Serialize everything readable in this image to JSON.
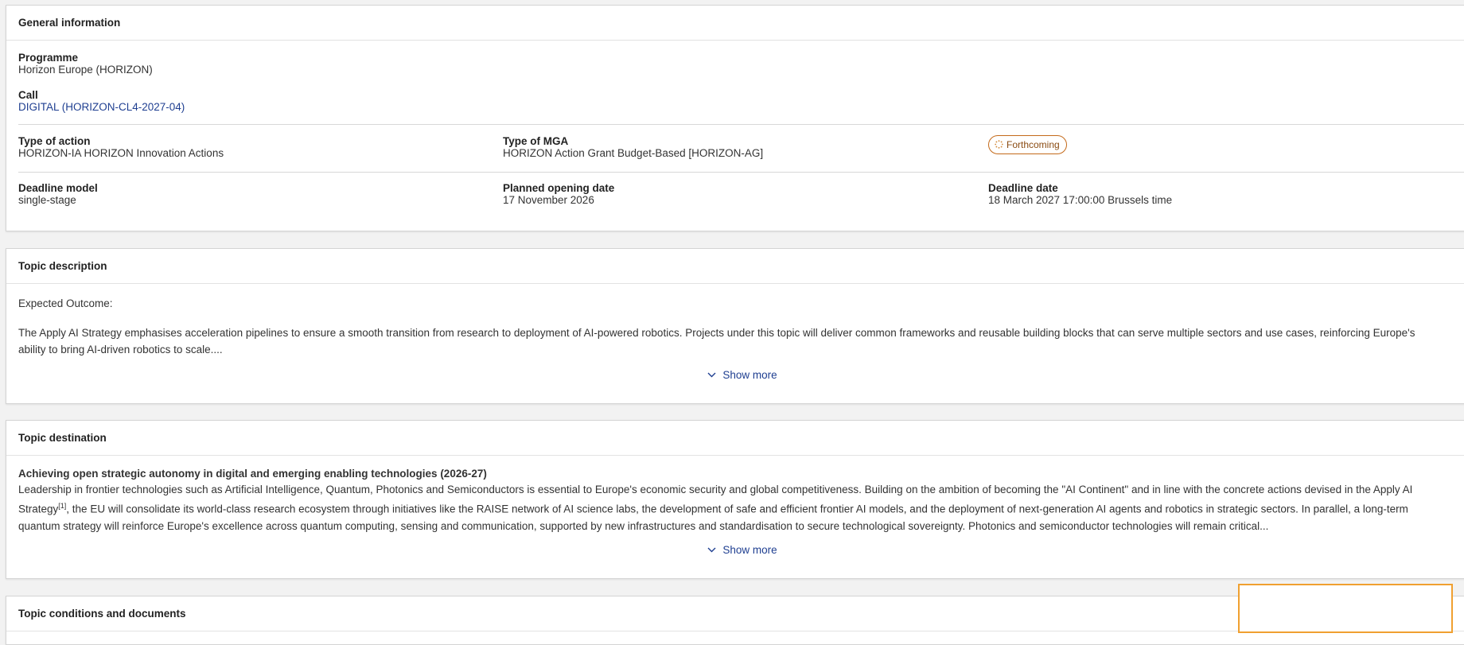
{
  "general": {
    "header": "General information",
    "programme_label": "Programme",
    "programme_value": "Horizon Europe (HORIZON)",
    "call_label": "Call",
    "call_value": "DIGITAL (HORIZON-CL4-2027-04)",
    "type_action_label": "Type of action",
    "type_action_value": "HORIZON-IA HORIZON Innovation Actions",
    "type_mga_label": "Type of MGA",
    "type_mga_value": "HORIZON Action Grant Budget-Based [HORIZON-AG]",
    "status_badge": "Forthcoming",
    "deadline_model_label": "Deadline model",
    "deadline_model_value": "single-stage",
    "opening_label": "Planned opening date",
    "opening_value": "17 November 2026",
    "deadline_date_label": "Deadline date",
    "deadline_date_value": "18 March 2027 17:00:00 Brussels time"
  },
  "description": {
    "header": "Topic description",
    "expected_outcome": "Expected Outcome:",
    "text": "The Apply AI Strategy emphasises acceleration pipelines to ensure a smooth transition from research to deployment of AI-powered robotics. Projects under this topic will deliver common frameworks and reusable building blocks that can serve multiple sectors and use cases, reinforcing Europe's ability to bring AI-driven robotics to scale....",
    "show_more": "Show more"
  },
  "destination": {
    "header": "Topic destination",
    "title": "Achieving open strategic autonomy in digital and emerging enabling technologies (2026-27)",
    "text_part1": "Leadership in frontier technologies such as Artificial Intelligence, Quantum, Photonics and Semiconductors is essential to Europe's economic security and global competitiveness. Building on the ambition of becoming the \"AI Continent\" and in line with the concrete actions devised in the Apply AI Strategy",
    "footnote": "[1]",
    "text_part2": ", the EU will consolidate its world-class research ecosystem through initiatives like the RAISE network of AI science labs, the development of safe and efficient frontier AI models, and the deployment of next-generation AI agents and robotics in strategic sectors. In parallel, a long-term quantum strategy will reinforce Europe's excellence across quantum computing, sensing and communication, supported by new infrastructures and standardisation to secure technological sovereignty. Photonics and semiconductor technologies will remain critical...",
    "show_more": "Show more"
  },
  "conditions": {
    "header": "Topic conditions and documents"
  },
  "colors": {
    "link": "#1f3f91",
    "badge_border": "#c46a1a",
    "highlight_box": "#f0a030"
  }
}
